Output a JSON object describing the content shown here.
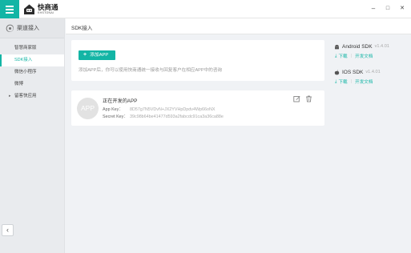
{
  "app": {
    "name": "快商通",
    "subtitle": "KHSTONAI"
  },
  "window_controls": {
    "minimize": "–",
    "maximize": "□",
    "close": "✕"
  },
  "sidebar": {
    "header": "渠道接入",
    "items": [
      {
        "label": "智慧商家版",
        "active": false,
        "caret": ""
      },
      {
        "label": "SDK接入",
        "active": true,
        "caret": ""
      },
      {
        "label": "微信小程序",
        "active": false,
        "caret": ""
      },
      {
        "label": "微博",
        "active": false,
        "caret": ""
      },
      {
        "label": "留客快应用",
        "active": false,
        "caret": "▸"
      }
    ],
    "collapse_glyph": "‹"
  },
  "content": {
    "title": "SDK接入",
    "add_button": "添加APP",
    "add_plus": "+",
    "intro": "添加APP后，你可以使用快商通统一接收与回复客户在相应APP中的咨询"
  },
  "app_card": {
    "avatar": "APP",
    "name": "正在开发的APP",
    "app_key_label": "App Key：",
    "app_key_value": "8D57g7N5VDvN+JX2YVHpDpdv4Wp66oNX",
    "secret_key_label": "Secret Key：",
    "secret_key_value": "39c98b64be41477d593a2fabcdc91ca3a36ca88e"
  },
  "sdk": [
    {
      "name": "Android SDK",
      "version": "v1.4.01",
      "download": "下载",
      "docs": "开发文档",
      "os": "android"
    },
    {
      "name": "IOS SDK",
      "version": "v1.4.01",
      "download": "下载",
      "docs": "开发文档",
      "os": "ios"
    }
  ],
  "colors": {
    "accent": "#13b5a5",
    "sidebar_bg": "#e9ebee",
    "page_bg": "#f0f2f5"
  }
}
